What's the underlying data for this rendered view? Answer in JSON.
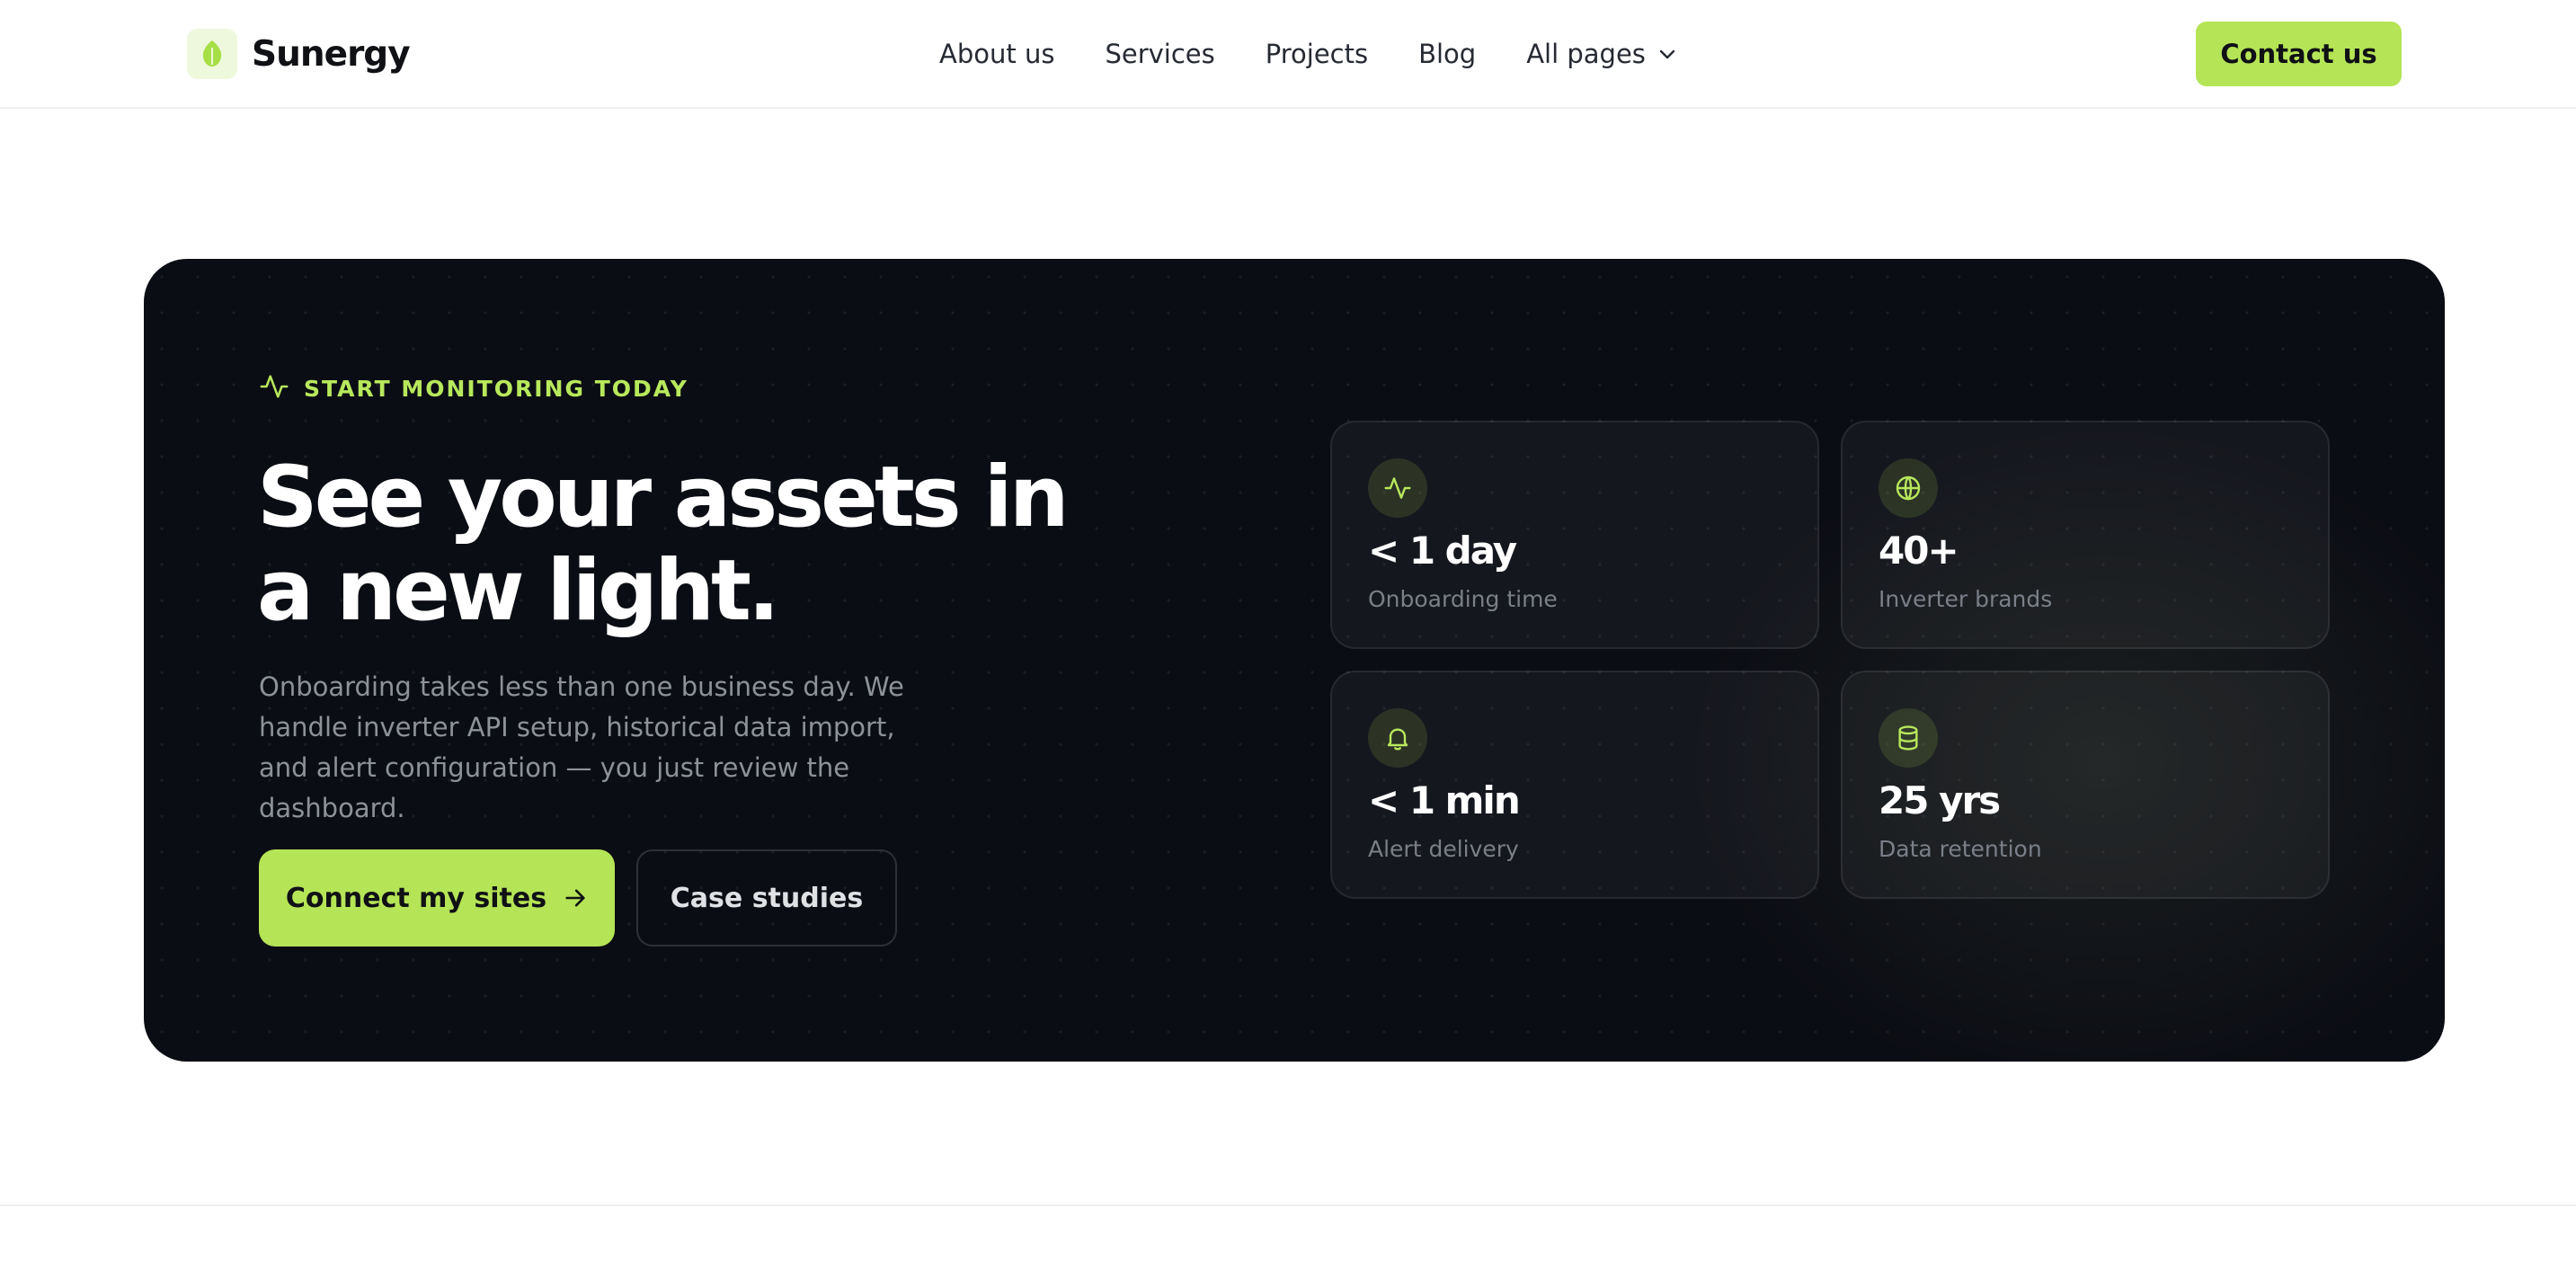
{
  "brand": {
    "name": "Sunergy"
  },
  "nav": {
    "links": [
      "About us",
      "Services",
      "Projects",
      "Blog"
    ],
    "all_pages": "All pages",
    "contact": "Contact us"
  },
  "hero": {
    "eyebrow": "START MONITORING TODAY",
    "headline_line1": "See your assets in",
    "headline_line2": "a new light.",
    "description": "Onboarding takes less than one business day. We handle inverter API setup, historical data import, and alert configuration — you just review the dashboard.",
    "primary_cta": "Connect my sites",
    "secondary_cta": "Case studies",
    "stats": [
      {
        "icon": "activity-icon",
        "value": "< 1 day",
        "label": "Onboarding time"
      },
      {
        "icon": "globe-icon",
        "value": "40+",
        "label": "Inverter brands"
      },
      {
        "icon": "bell-icon",
        "value": "< 1 min",
        "label": "Alert delivery"
      },
      {
        "icon": "database-icon",
        "value": "25 yrs",
        "label": "Data retention"
      }
    ]
  },
  "colors": {
    "accent": "#b5e456",
    "hero_bg": "#0b0d14",
    "text_dark": "#0f1115",
    "text_muted": "#8d919a"
  }
}
